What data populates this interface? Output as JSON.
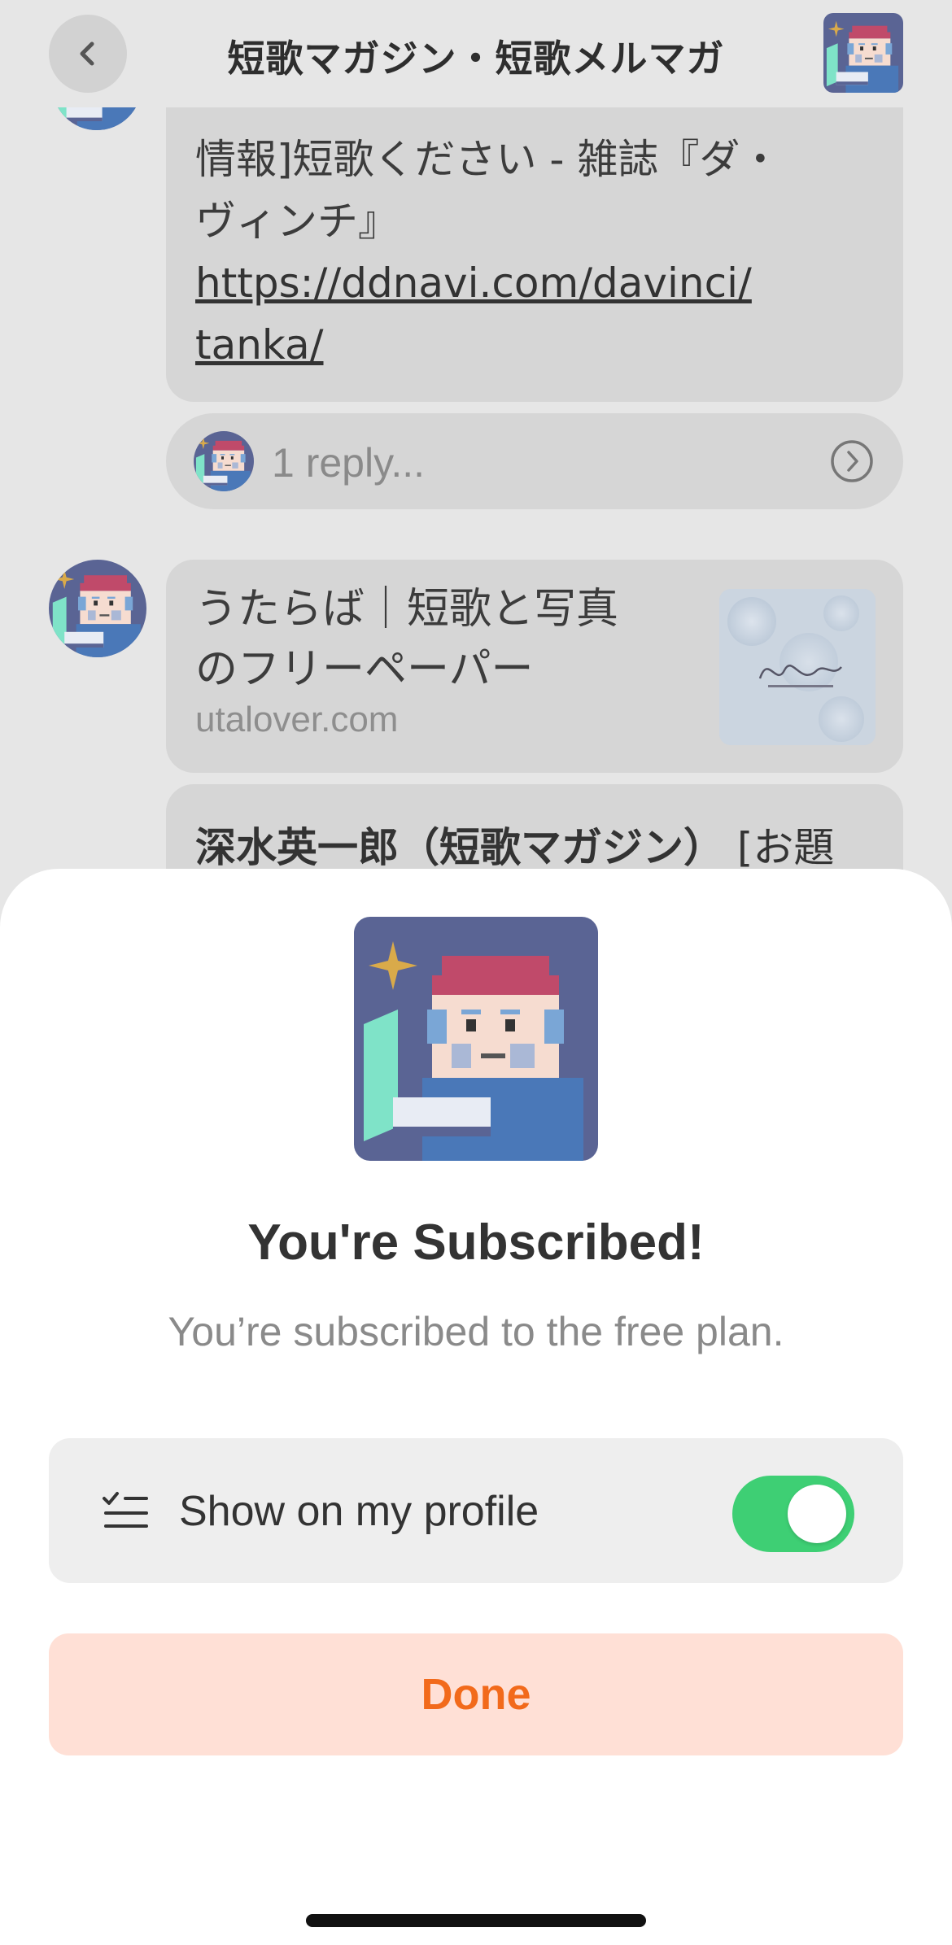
{
  "header": {
    "title": "短歌マガジン・短歌メルマガ",
    "back_icon": "chevron-left-icon"
  },
  "messages": [
    {
      "text_line1": "情報]短歌ください - 雑誌『ダ・",
      "text_line2": "ヴィンチ』",
      "link_line1": "https://ddnavi.com/davinci/",
      "link_line2": "tanka/"
    }
  ],
  "reply": {
    "label": "1 reply...",
    "icon": "chevron-right-circle-icon"
  },
  "link_card": {
    "title_line1": "うたらば｜短歌と写真",
    "title_line2": "のフリーペーパー",
    "domain": "utalover.com"
  },
  "next_message": {
    "sender": "深水英一郎（短歌マガジン）",
    "text": " [お題"
  },
  "sheet": {
    "title": "You're Subscribed!",
    "subtitle": "You’re subscribed to the free plan.",
    "profile_row": {
      "label": "Show on my profile",
      "icon": "checklist-icon",
      "toggle_on": true
    },
    "done_label": "Done"
  },
  "colors": {
    "toggle": "#3ecf74",
    "done_bg": "#ffe0d6",
    "done_text": "#f26a1b",
    "avatar_bg": "#5a6494",
    "avatar_cap": "#c04a6a",
    "star": "#d9aa4a",
    "laptop": "#7fe3c8"
  }
}
